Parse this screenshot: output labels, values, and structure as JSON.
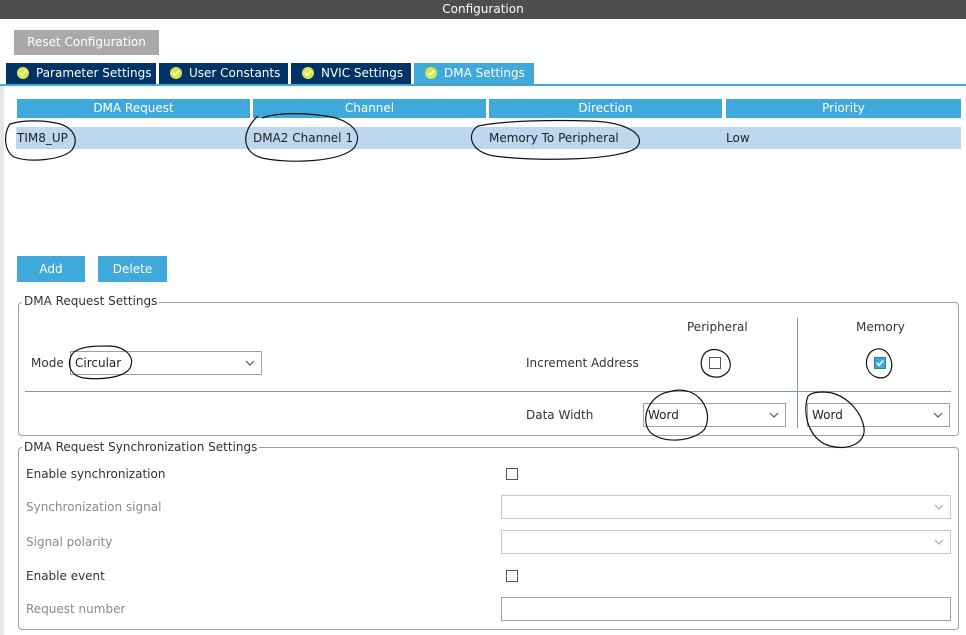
{
  "window": {
    "title": "Configuration"
  },
  "toolbar": {
    "reset_label": "Reset Configuration"
  },
  "tabs": [
    {
      "label": "Parameter Settings",
      "icon": "check-circle-icon",
      "active": false
    },
    {
      "label": "User Constants",
      "icon": "check-circle-icon",
      "active": false
    },
    {
      "label": "NVIC Settings",
      "icon": "check-circle-icon",
      "active": false
    },
    {
      "label": "DMA Settings",
      "icon": "check-circle-icon",
      "active": true
    }
  ],
  "dma_table": {
    "columns": [
      "DMA Request",
      "Channel",
      "Direction",
      "Priority"
    ],
    "rows": [
      {
        "request": "TIM8_UP",
        "channel": "DMA2 Channel 1",
        "direction": "Memory To Peripheral",
        "priority": "Low"
      }
    ]
  },
  "actions": {
    "add_label": "Add",
    "delete_label": "Delete"
  },
  "request_settings": {
    "legend": "DMA Request Settings",
    "mode_label": "Mode",
    "mode_value": "Circular",
    "peripheral_header": "Peripheral",
    "memory_header": "Memory",
    "increment_label": "Increment Address",
    "peripheral_increment": false,
    "memory_increment": true,
    "data_width_label": "Data Width",
    "peripheral_width": "Word",
    "memory_width": "Word"
  },
  "sync_settings": {
    "legend": "DMA Request Synchronization Settings",
    "enable_sync_label": "Enable synchronization",
    "sync_signal_label": "Synchronization signal",
    "signal_polarity_label": "Signal polarity",
    "enable_event_label": "Enable event",
    "request_number_label": "Request number"
  },
  "colors": {
    "accent": "#3fa9db",
    "tab_dark": "#003366",
    "row_selected": "#bdd7ee",
    "titlebar": "#4e4e4e"
  }
}
